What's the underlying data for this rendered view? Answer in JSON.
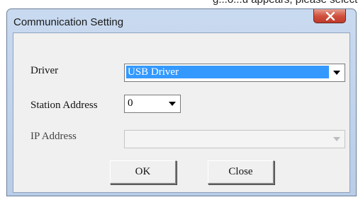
{
  "page": {
    "partial_caption": "g...o...u appears, please select USB_Driver..."
  },
  "window": {
    "title": "Communication Setting",
    "close_icon": "close-icon"
  },
  "form": {
    "driver": {
      "label": "Driver",
      "value": "USB Driver"
    },
    "station_address": {
      "label": "Station Address",
      "value": "0"
    },
    "ip_address": {
      "label": "IP Address",
      "value": ""
    }
  },
  "buttons": {
    "ok": "OK",
    "close": "Close"
  },
  "colors": {
    "selection": "#3399ff",
    "dialog_bg": "#f0f0f0",
    "frame": "#c9daf0",
    "close_button": "#c0392b"
  }
}
